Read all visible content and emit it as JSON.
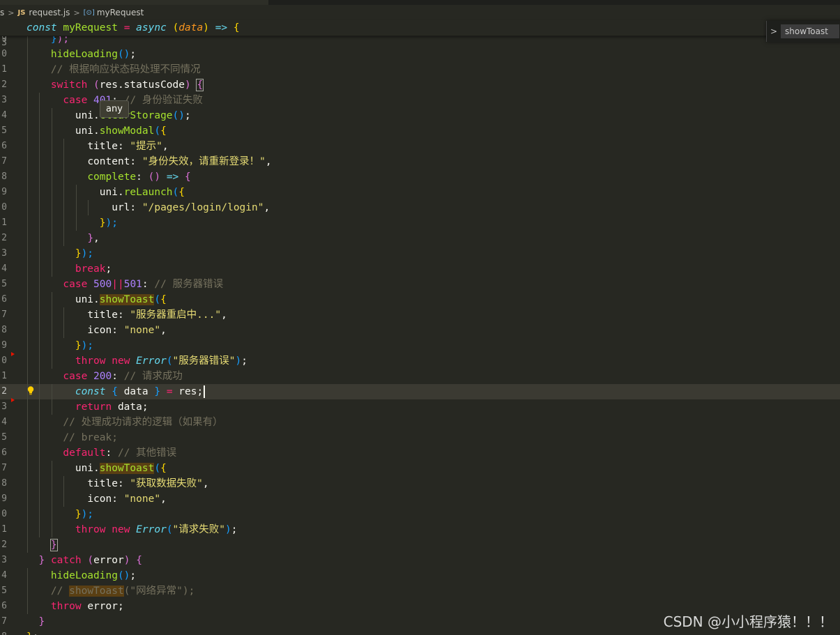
{
  "breadcrumb": {
    "folder": "s",
    "file_badge": "JS",
    "file": "request.js",
    "symbol_icon": "symbol-method-icon",
    "symbol": "myRequest"
  },
  "sticky": {
    "line_number": "3",
    "tokens": [
      {
        "t": "const ",
        "c": "kwi"
      },
      {
        "t": "myRequest ",
        "c": "fn"
      },
      {
        "t": "= ",
        "c": "op"
      },
      {
        "t": "async ",
        "c": "kwi"
      },
      {
        "t": "(",
        "c": "b1"
      },
      {
        "t": "data",
        "c": "param"
      },
      {
        "t": ") ",
        "c": "b1"
      },
      {
        "t": "=> ",
        "c": "kwi"
      },
      {
        "t": "{",
        "c": "b1"
      }
    ]
  },
  "find_widget": {
    "value": "showToast"
  },
  "hover_tooltip": "any",
  "watermark": "CSDN @小小程序猿！！！",
  "lines": [
    {
      "n": "9",
      "guides": [
        1
      ],
      "tokens": [
        {
          "t": "    "
        },
        {
          "t": "}",
          "c": "b3"
        },
        {
          "t": ");",
          "c": "b2"
        }
      ]
    },
    {
      "n": "0",
      "guides": [
        1
      ],
      "tokens": [
        {
          "t": "    "
        },
        {
          "t": "hideLoading",
          "c": "fn"
        },
        {
          "t": "()",
          "c": "b3"
        },
        {
          "t": ";"
        }
      ]
    },
    {
      "n": "1",
      "guides": [
        1
      ],
      "tokens": [
        {
          "t": "    "
        },
        {
          "t": "// 根据响应状态码处理不同情况",
          "c": "cm"
        }
      ]
    },
    {
      "n": "2",
      "guides": [
        1
      ],
      "tokens": [
        {
          "t": "    "
        },
        {
          "t": "switch ",
          "c": "kw"
        },
        {
          "t": "(",
          "c": "b2"
        },
        {
          "t": "res.statusCode"
        },
        {
          "t": ") ",
          "c": "b2"
        },
        {
          "t": "{",
          "c": "b2",
          "hl": true
        }
      ]
    },
    {
      "n": "3",
      "guides": [
        1,
        2
      ],
      "tokens": [
        {
          "t": "      "
        },
        {
          "t": "case ",
          "c": "kw"
        },
        {
          "t": "401",
          "c": "num"
        },
        {
          "t": ": "
        },
        {
          "t": "// 身份验证失败",
          "c": "cm"
        }
      ]
    },
    {
      "n": "4",
      "guides": [
        1,
        2,
        3
      ],
      "tokens": [
        {
          "t": "        "
        },
        {
          "t": "uni."
        },
        {
          "t": "clearStorage",
          "c": "fn"
        },
        {
          "t": "()",
          "c": "b3"
        },
        {
          "t": ";"
        }
      ]
    },
    {
      "n": "5",
      "guides": [
        1,
        2,
        3
      ],
      "tokens": [
        {
          "t": "        "
        },
        {
          "t": "uni."
        },
        {
          "t": "showModal",
          "c": "fn"
        },
        {
          "t": "(",
          "c": "b3"
        },
        {
          "t": "{",
          "c": "b1"
        }
      ]
    },
    {
      "n": "6",
      "guides": [
        1,
        2,
        3,
        4
      ],
      "tokens": [
        {
          "t": "          "
        },
        {
          "t": "title: "
        },
        {
          "t": "\"提示\"",
          "c": "str"
        },
        {
          "t": ","
        }
      ]
    },
    {
      "n": "7",
      "guides": [
        1,
        2,
        3,
        4
      ],
      "tokens": [
        {
          "t": "          "
        },
        {
          "t": "content: "
        },
        {
          "t": "\"身份失效，请重新登录！\"",
          "c": "str"
        },
        {
          "t": ","
        }
      ]
    },
    {
      "n": "8",
      "guides": [
        1,
        2,
        3,
        4
      ],
      "tokens": [
        {
          "t": "          "
        },
        {
          "t": "complete",
          "c": "prop"
        },
        {
          "t": ": "
        },
        {
          "t": "()",
          "c": "b2"
        },
        {
          "t": " => ",
          "c": "kwi"
        },
        {
          "t": "{",
          "c": "b2"
        }
      ]
    },
    {
      "n": "9",
      "guides": [
        1,
        2,
        3,
        4,
        5
      ],
      "tokens": [
        {
          "t": "            "
        },
        {
          "t": "uni."
        },
        {
          "t": "reLaunch",
          "c": "fn"
        },
        {
          "t": "(",
          "c": "b3"
        },
        {
          "t": "{",
          "c": "b1"
        }
      ]
    },
    {
      "n": "0",
      "guides": [
        1,
        2,
        3,
        4,
        5,
        6
      ],
      "tokens": [
        {
          "t": "              "
        },
        {
          "t": "url: "
        },
        {
          "t": "\"/pages/login/login\"",
          "c": "str"
        },
        {
          "t": ","
        }
      ]
    },
    {
      "n": "1",
      "guides": [
        1,
        2,
        3,
        4,
        5
      ],
      "tokens": [
        {
          "t": "            "
        },
        {
          "t": "}",
          "c": "b1"
        },
        {
          "t": ");",
          "c": "b3"
        }
      ]
    },
    {
      "n": "2",
      "guides": [
        1,
        2,
        3,
        4
      ],
      "tokens": [
        {
          "t": "          "
        },
        {
          "t": "}",
          "c": "b2"
        },
        {
          "t": ","
        }
      ]
    },
    {
      "n": "3",
      "guides": [
        1,
        2,
        3
      ],
      "tokens": [
        {
          "t": "        "
        },
        {
          "t": "}",
          "c": "b1"
        },
        {
          "t": ");",
          "c": "b3"
        }
      ]
    },
    {
      "n": "4",
      "guides": [
        1,
        2,
        3
      ],
      "tokens": [
        {
          "t": "        "
        },
        {
          "t": "break",
          "c": "kw"
        },
        {
          "t": ";"
        }
      ]
    },
    {
      "n": "5",
      "guides": [
        1,
        2
      ],
      "tokens": [
        {
          "t": "      "
        },
        {
          "t": "case ",
          "c": "kw"
        },
        {
          "t": "500",
          "c": "num"
        },
        {
          "t": "||",
          "c": "op"
        },
        {
          "t": "501",
          "c": "num"
        },
        {
          "t": ": "
        },
        {
          "t": "// 服务器错误",
          "c": "cm"
        }
      ]
    },
    {
      "n": "6",
      "guides": [
        1,
        2,
        3
      ],
      "tokens": [
        {
          "t": "        "
        },
        {
          "t": "uni."
        },
        {
          "t": "showToast",
          "c": "fnhl"
        },
        {
          "t": "(",
          "c": "b3"
        },
        {
          "t": "{",
          "c": "b1"
        }
      ]
    },
    {
      "n": "7",
      "guides": [
        1,
        2,
        3,
        4
      ],
      "tokens": [
        {
          "t": "          "
        },
        {
          "t": "title: "
        },
        {
          "t": "\"服务器重启中...\"",
          "c": "str"
        },
        {
          "t": ","
        }
      ]
    },
    {
      "n": "8",
      "guides": [
        1,
        2,
        3,
        4
      ],
      "tokens": [
        {
          "t": "          "
        },
        {
          "t": "icon: "
        },
        {
          "t": "\"none\"",
          "c": "str"
        },
        {
          "t": ","
        }
      ]
    },
    {
      "n": "9",
      "guides": [
        1,
        2,
        3
      ],
      "tokens": [
        {
          "t": "        "
        },
        {
          "t": "}",
          "c": "b1"
        },
        {
          "t": ");",
          "c": "b3"
        }
      ]
    },
    {
      "n": "0",
      "guides": [
        1,
        2,
        3
      ],
      "bp": true,
      "tokens": [
        {
          "t": "        "
        },
        {
          "t": "throw ",
          "c": "kw"
        },
        {
          "t": "new ",
          "c": "kw"
        },
        {
          "t": "Error",
          "c": "cls"
        },
        {
          "t": "(",
          "c": "b3"
        },
        {
          "t": "\"服务器错误\"",
          "c": "str"
        },
        {
          "t": ")",
          "c": "b3"
        },
        {
          "t": ";"
        }
      ]
    },
    {
      "n": "1",
      "guides": [
        1,
        2
      ],
      "tokens": [
        {
          "t": "      "
        },
        {
          "t": "case ",
          "c": "kw"
        },
        {
          "t": "200",
          "c": "num"
        },
        {
          "t": ": "
        },
        {
          "t": "// 请求成功",
          "c": "cm"
        }
      ]
    },
    {
      "n": "2",
      "guides": [
        1,
        2,
        3
      ],
      "current": true,
      "bulb": true,
      "tokens": [
        {
          "t": "        "
        },
        {
          "t": "const ",
          "c": "kwi"
        },
        {
          "t": "{ ",
          "c": "b3"
        },
        {
          "t": "data "
        },
        {
          "t": "} ",
          "c": "b3"
        },
        {
          "t": "= ",
          "c": "op"
        },
        {
          "t": "res;"
        }
      ]
    },
    {
      "n": "3",
      "guides": [
        1,
        2,
        3
      ],
      "bp": true,
      "tokens": [
        {
          "t": "        "
        },
        {
          "t": "return ",
          "c": "kw"
        },
        {
          "t": "data;"
        }
      ]
    },
    {
      "n": "4",
      "guides": [
        1,
        2
      ],
      "tokens": [
        {
          "t": "      "
        },
        {
          "t": "// 处理成功请求的逻辑（如果有）",
          "c": "cm"
        }
      ]
    },
    {
      "n": "5",
      "guides": [
        1,
        2
      ],
      "tokens": [
        {
          "t": "      "
        },
        {
          "t": "// break;",
          "c": "cm"
        }
      ]
    },
    {
      "n": "6",
      "guides": [
        1,
        2
      ],
      "tokens": [
        {
          "t": "      "
        },
        {
          "t": "default",
          "c": "kw"
        },
        {
          "t": ": "
        },
        {
          "t": "// 其他错误",
          "c": "cm"
        }
      ]
    },
    {
      "n": "7",
      "guides": [
        1,
        2,
        3
      ],
      "tokens": [
        {
          "t": "        "
        },
        {
          "t": "uni."
        },
        {
          "t": "showToast",
          "c": "fnhl"
        },
        {
          "t": "(",
          "c": "b3"
        },
        {
          "t": "{",
          "c": "b1"
        }
      ]
    },
    {
      "n": "8",
      "guides": [
        1,
        2,
        3,
        4
      ],
      "tokens": [
        {
          "t": "          "
        },
        {
          "t": "title: "
        },
        {
          "t": "\"获取数据失败\"",
          "c": "str"
        },
        {
          "t": ","
        }
      ]
    },
    {
      "n": "9",
      "guides": [
        1,
        2,
        3,
        4
      ],
      "tokens": [
        {
          "t": "          "
        },
        {
          "t": "icon: "
        },
        {
          "t": "\"none\"",
          "c": "str"
        },
        {
          "t": ","
        }
      ]
    },
    {
      "n": "0",
      "guides": [
        1,
        2,
        3
      ],
      "tokens": [
        {
          "t": "        "
        },
        {
          "t": "}",
          "c": "b1"
        },
        {
          "t": ");",
          "c": "b3"
        }
      ]
    },
    {
      "n": "1",
      "guides": [
        1,
        2,
        3
      ],
      "tokens": [
        {
          "t": "        "
        },
        {
          "t": "throw ",
          "c": "kw"
        },
        {
          "t": "new ",
          "c": "kw"
        },
        {
          "t": "Error",
          "c": "cls"
        },
        {
          "t": "(",
          "c": "b3"
        },
        {
          "t": "\"请求失败\"",
          "c": "str"
        },
        {
          "t": ")",
          "c": "b3"
        },
        {
          "t": ";"
        }
      ]
    },
    {
      "n": "2",
      "guides": [
        1
      ],
      "tokens": [
        {
          "t": "    "
        },
        {
          "t": "}",
          "c": "b2",
          "hl": true
        }
      ]
    },
    {
      "n": "3",
      "guides": [],
      "tokens": [
        {
          "t": "  "
        },
        {
          "t": "} ",
          "c": "b2"
        },
        {
          "t": "catch ",
          "c": "kw"
        },
        {
          "t": "(",
          "c": "b2"
        },
        {
          "t": "error"
        },
        {
          "t": ") ",
          "c": "b2"
        },
        {
          "t": "{",
          "c": "b2"
        }
      ]
    },
    {
      "n": "4",
      "guides": [
        1
      ],
      "tokens": [
        {
          "t": "    "
        },
        {
          "t": "hideLoading",
          "c": "fn"
        },
        {
          "t": "()",
          "c": "b3"
        },
        {
          "t": ";"
        }
      ]
    },
    {
      "n": "5",
      "guides": [
        1
      ],
      "tokens": [
        {
          "t": "    "
        },
        {
          "t": "// ",
          "c": "cm"
        },
        {
          "t": "showToast",
          "c": "cmhl"
        },
        {
          "t": "(\"网络异常\");",
          "c": "cm"
        }
      ]
    },
    {
      "n": "6",
      "guides": [
        1
      ],
      "tokens": [
        {
          "t": "    "
        },
        {
          "t": "throw ",
          "c": "kw"
        },
        {
          "t": "error;"
        }
      ]
    },
    {
      "n": "7",
      "guides": [],
      "tokens": [
        {
          "t": "  "
        },
        {
          "t": "}",
          "c": "b2"
        }
      ]
    },
    {
      "n": "8",
      "guides": [],
      "tokens": [
        {
          "t": "}",
          "c": "b1"
        },
        {
          "t": ";"
        }
      ]
    }
  ]
}
